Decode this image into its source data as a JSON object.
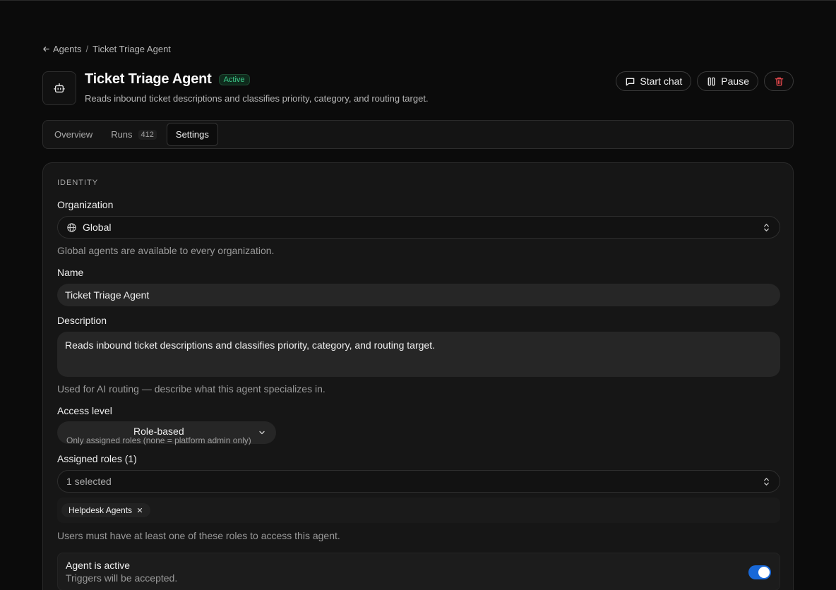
{
  "breadcrumb": {
    "back_label": "Agents",
    "separator": "/",
    "current": "Ticket Triage Agent"
  },
  "header": {
    "title": "Ticket Triage Agent",
    "status_badge": "Active",
    "subtitle": "Reads inbound ticket descriptions and classifies priority, category, and routing target.",
    "icon": "bot-icon",
    "actions": {
      "start_chat": "Start chat",
      "pause": "Pause",
      "delete_icon": "trash-icon"
    }
  },
  "tabs": [
    {
      "label": "Overview"
    },
    {
      "label": "Runs",
      "count": "412"
    },
    {
      "label": "Settings",
      "active": true
    }
  ],
  "identity": {
    "section_label": "IDENTITY",
    "organization": {
      "label": "Organization",
      "value": "Global",
      "icon": "globe-icon",
      "hint": "Global agents are available to every organization."
    },
    "name": {
      "label": "Name",
      "value": "Ticket Triage Agent"
    },
    "description": {
      "label": "Description",
      "value": "Reads inbound ticket descriptions and classifies priority, category, and routing target.",
      "hint": "Used for AI routing — describe what this agent specializes in."
    },
    "access_level": {
      "label": "Access level",
      "value": "Role-based",
      "sub": "Only assigned roles (none = platform admin only)"
    },
    "assigned_roles": {
      "label": "Assigned roles (1)",
      "placeholder": "1 selected",
      "chips": [
        "Helpdesk Agents"
      ],
      "hint": "Users must have at least one of these roles to access this agent."
    },
    "active_toggle": {
      "title": "Agent is active",
      "sub": "Triggers will be accepted.",
      "on": true
    }
  },
  "colors": {
    "accent": "#1868d8",
    "badge_green": "#3ecf8e",
    "delete_red": "#e5484d"
  }
}
